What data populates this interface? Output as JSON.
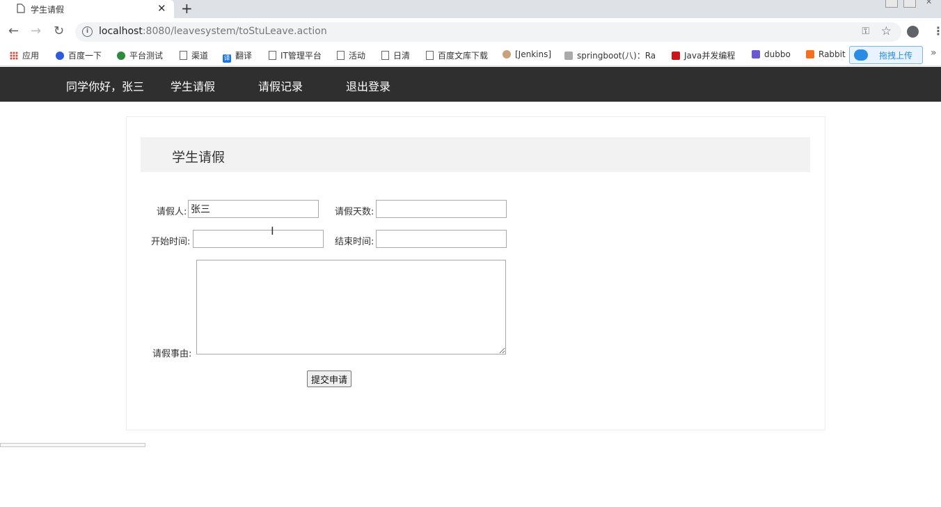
{
  "browser": {
    "tab_title": "学生请假",
    "url_host": "localhost",
    "url_rest": ":8080/leavesystem/toStuLeave.action",
    "bookmarks": [
      {
        "label": "应用",
        "icon": "apps-grid-icon"
      },
      {
        "label": "百度一下",
        "icon": "baidu-icon"
      },
      {
        "label": "平台测试",
        "icon": "platform-icon"
      },
      {
        "label": "渠道",
        "icon": "page-icon"
      },
      {
        "label": "翻译",
        "icon": "translate-icon"
      },
      {
        "label": "IT管理平台",
        "icon": "page-icon"
      },
      {
        "label": "活动",
        "icon": "page-icon"
      },
      {
        "label": "日清",
        "icon": "page-icon"
      },
      {
        "label": "百度文库下载",
        "icon": "page-icon"
      },
      {
        "label": "[Jenkins]",
        "icon": "jenkins-icon"
      },
      {
        "label": "springboot(八)：Ra",
        "icon": "site-icon"
      },
      {
        "label": "Java并发编程",
        "icon": "csdn-icon"
      },
      {
        "label": "dubbo",
        "icon": "dubbo-icon"
      },
      {
        "label": "Rabbit",
        "icon": "rabbitmq-icon"
      }
    ],
    "upload_label": "拖拽上传"
  },
  "nav": {
    "greeting": "同学你好，张三",
    "items": [
      "学生请假",
      "请假记录",
      "退出登录"
    ]
  },
  "form": {
    "heading": "学生请假",
    "applicant_label": "请假人:",
    "applicant_value": "张三",
    "days_label": "请假天数:",
    "days_value": "",
    "start_label": "开始时间:",
    "start_value": "",
    "end_label": "结束时间:",
    "end_value": "",
    "reason_label": "请假事由:",
    "reason_value": "",
    "submit_label": "提交申请"
  },
  "colors": {
    "nav_bg": "#2f2f2f",
    "header_bg": "#f2f2f2"
  }
}
